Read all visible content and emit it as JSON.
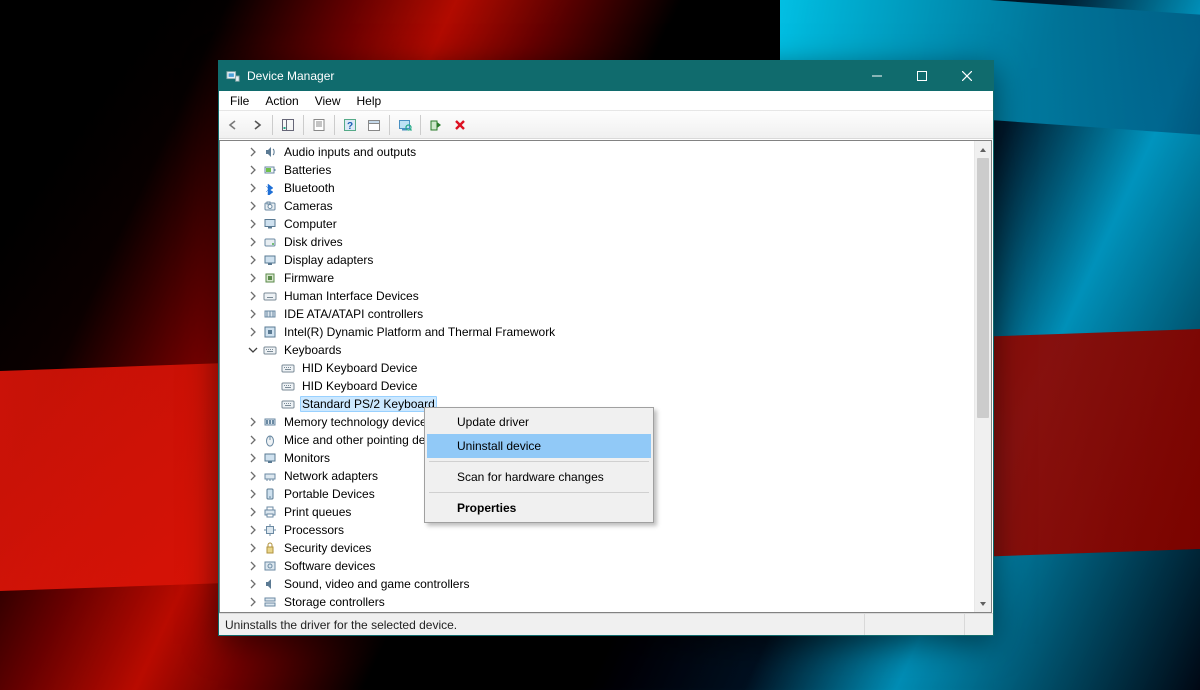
{
  "window": {
    "title": "Device Manager"
  },
  "menu": {
    "file": "File",
    "action": "Action",
    "view": "View",
    "help": "Help"
  },
  "tree": {
    "items": [
      {
        "label": "Audio inputs and outputs"
      },
      {
        "label": "Batteries"
      },
      {
        "label": "Bluetooth"
      },
      {
        "label": "Cameras"
      },
      {
        "label": "Computer"
      },
      {
        "label": "Disk drives"
      },
      {
        "label": "Display adapters"
      },
      {
        "label": "Firmware"
      },
      {
        "label": "Human Interface Devices"
      },
      {
        "label": "IDE ATA/ATAPI controllers"
      },
      {
        "label": "Intel(R) Dynamic Platform and Thermal Framework"
      },
      {
        "label": "Keyboards"
      },
      {
        "label": "Memory technology devices"
      },
      {
        "label": "Mice and other pointing devices"
      },
      {
        "label": "Monitors"
      },
      {
        "label": "Network adapters"
      },
      {
        "label": "Portable Devices"
      },
      {
        "label": "Print queues"
      },
      {
        "label": "Processors"
      },
      {
        "label": "Security devices"
      },
      {
        "label": "Software devices"
      },
      {
        "label": "Sound, video and game controllers"
      },
      {
        "label": "Storage controllers"
      }
    ],
    "keyboards_children": [
      {
        "label": "HID Keyboard Device"
      },
      {
        "label": "HID Keyboard Device"
      },
      {
        "label": "Standard PS/2 Keyboard"
      }
    ]
  },
  "context_menu": {
    "update": "Update driver",
    "uninstall": "Uninstall device",
    "scan": "Scan for hardware changes",
    "properties": "Properties"
  },
  "statusbar": {
    "text": "Uninstalls the driver for the selected device."
  }
}
